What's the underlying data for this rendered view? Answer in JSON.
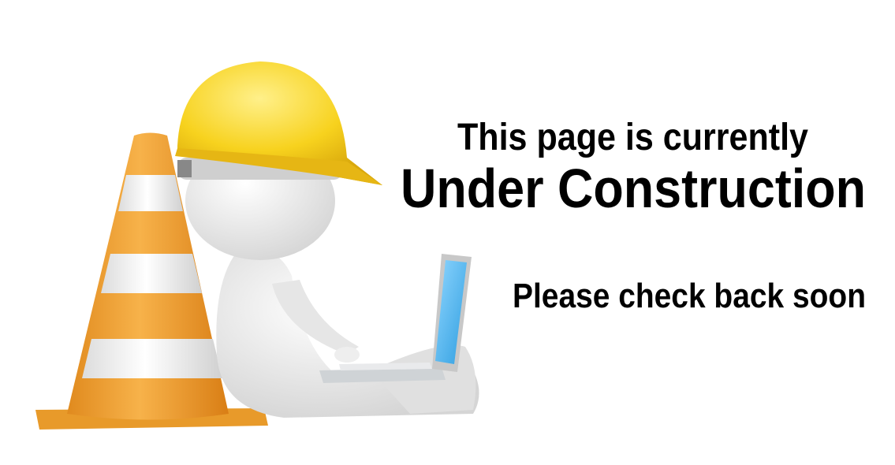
{
  "message": {
    "line1": "This page is currently",
    "line2": "Under Construction",
    "line3": "Please check back soon"
  },
  "illustration": {
    "icons": [
      "traffic-cone-icon",
      "hard-hat-icon",
      "laptop-icon"
    ],
    "colors": {
      "cone_orange": "#f0a030",
      "hat_yellow": "#f7d21e",
      "screen_blue": "#4fb8f0"
    }
  }
}
